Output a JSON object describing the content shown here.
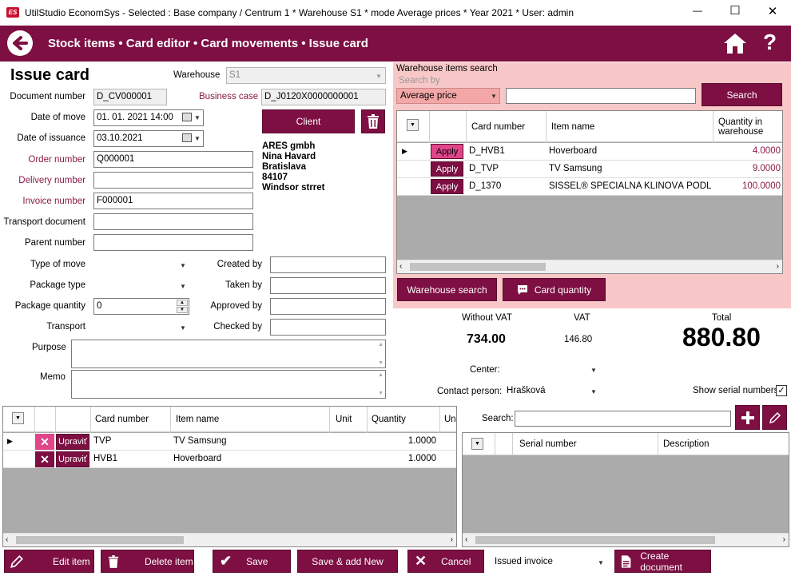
{
  "window": {
    "title": "UtilStudio EconomSys - Selected : Base company / Centrum 1 * Warehouse S1 * mode Average prices * Year 2021 * User: admin",
    "logo": "ES",
    "minimize": "—",
    "maximize": "☐",
    "close": "✕"
  },
  "header": {
    "breadcrumb": "Stock items • Card editor • Card movements • Issue card",
    "help": "?"
  },
  "form": {
    "title": "Issue card",
    "warehouse_label": "Warehouse",
    "warehouse_value": "S1",
    "document_number_label": "Document number",
    "document_number_value": "D_CV000001",
    "business_case_label": "Business case",
    "business_case_value": "D_J0120X0000000001",
    "date_of_move_label": "Date of move",
    "date_of_move_value": "01. 01. 2021 14:00",
    "date_of_issuance_label": "Date of issuance",
    "date_of_issuance_value": "03.10.2021",
    "client_button": "Client",
    "order_number_label": "Order number",
    "order_number_value": "Q000001",
    "delivery_number_label": "Delivery number",
    "delivery_number_value": "",
    "invoice_number_label": "Invoice number",
    "invoice_number_value": "F000001",
    "transport_document_label": "Transport document",
    "transport_document_value": "",
    "parent_number_label": "Parent number",
    "parent_number_value": "",
    "client_address": [
      "ARES gmbh",
      "Nina Havard",
      "Bratislava",
      "84107",
      "Windsor strret"
    ],
    "type_of_move_label": "Type of move",
    "package_type_label": "Package type",
    "package_quantity_label": "Package quantity",
    "package_quantity_value": "0",
    "transport_label": "Transport",
    "created_by_label": "Created by",
    "taken_by_label": "Taken by",
    "approved_by_label": "Approved by",
    "checked_by_label": "Checked by",
    "purpose_label": "Purpose",
    "memo_label": "Memo"
  },
  "warehouse_search": {
    "title": "Warehouse items search",
    "search_by_label": "Search by",
    "search_by_value": "Average price",
    "search_button": "Search",
    "columns": [
      "Card number",
      "Item name",
      "Quantity in warehouse"
    ],
    "apply_label": "Apply",
    "rows": [
      {
        "card": "D_HVB1",
        "name": "Hoverboard",
        "qty": "4.0000"
      },
      {
        "card": "D_TVP",
        "name": "TV Samsung",
        "qty": "9.0000"
      },
      {
        "card": "D_1370",
        "name": "SISSEL® ŠPECIÁLNA KLINOVÁ PODL...",
        "qty": "100.0000"
      }
    ],
    "warehouse_search_button": "Warehouse search",
    "card_quantity_button": "Card quantity"
  },
  "totals": {
    "without_vat_label": "Without VAT",
    "without_vat_value": "734.00",
    "vat_label": "VAT",
    "vat_value": "146.80",
    "total_label": "Total",
    "total_value": "880.80",
    "center_label": "Center:",
    "contact_person_label": "Contact person:",
    "contact_person_value": "Hrašková",
    "show_serial_label": "Show serial numbers"
  },
  "items_grid": {
    "columns": [
      "Card number",
      "Item name",
      "Unit",
      "Quantity",
      "Un"
    ],
    "edit_label": "Upraviť",
    "rows": [
      {
        "card": "TVP",
        "name": "TV Samsung",
        "unit": "",
        "qty": "1.0000"
      },
      {
        "card": "HVB1",
        "name": "Hoverboard",
        "unit": "",
        "qty": "1.0000"
      }
    ]
  },
  "serial": {
    "search_label": "Search:",
    "columns": [
      "Serial number",
      "Description"
    ]
  },
  "footer": {
    "edit_item": "Edit item",
    "delete_item": "Delete item",
    "save": "Save",
    "save_add_new": "Save & add New",
    "cancel": "Cancel",
    "doc_type_value": "Issued invoice",
    "create_document": "Create document"
  },
  "colors": {
    "brand": "#7d0f42",
    "search_panel_bg": "#f8c8c8",
    "apply_pink": "#e0458a"
  }
}
